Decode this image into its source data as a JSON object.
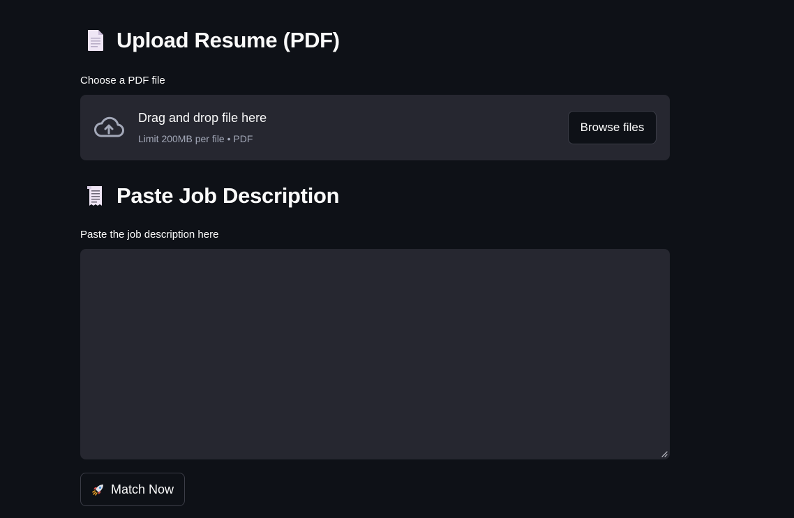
{
  "upload_section": {
    "heading": "Upload Resume (PDF)",
    "heading_icon": "page-document-icon",
    "field_label": "Choose a PDF file",
    "dropzone": {
      "title": "Drag and drop file here",
      "limit_text": "Limit 200MB per file • PDF",
      "icon": "cloud-upload-icon",
      "browse_label": "Browse files"
    }
  },
  "job_section": {
    "heading": "Paste Job Description",
    "heading_icon": "receipt-scroll-icon",
    "field_label": "Paste the job description here",
    "textarea_value": ""
  },
  "actions": {
    "match_label": "Match Now",
    "match_icon": "rocket-icon"
  },
  "colors": {
    "background": "#0e1117",
    "surface": "#262730",
    "text": "#fafafa",
    "muted_text": "#a3a8b8",
    "border": "#3b3d47"
  }
}
